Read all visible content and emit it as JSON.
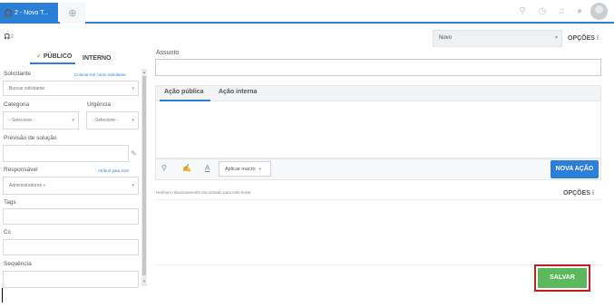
{
  "top_tabs": {
    "active_label": "2 - Novo T...",
    "new_tab_icon": "plus-circle-icon"
  },
  "top_icons": [
    "search-icon",
    "clock-icon",
    "bell-icon",
    "chat-icon"
  ],
  "ticket_number": "2",
  "status": {
    "selected": "Novo"
  },
  "opcoes_top": "OPÇÕES",
  "left_panel": {
    "tab_public": "PÚBLICO",
    "tab_internal": "INTERNO",
    "solicitante_label": "Solicitante",
    "solicitante_link": "Colocar-me como solicitante",
    "solicitante_placeholder": "Buscar solicitante",
    "categoria_label": "Categoria",
    "categoria_value": "- Selecione -",
    "urgencia_label": "Urgência",
    "urgencia_value": "- Selecione -",
    "previsao_label": "Previsão de solução",
    "responsavel_label": "Responsável",
    "responsavel_link": "Atribuir para mim",
    "responsavel_value": "Administradores »",
    "tags_label": "Tags",
    "cc_label": "Cc",
    "sequencia_label": "Sequência"
  },
  "right_panel": {
    "assunto_label": "Assunto",
    "tab_public_action": "Ação pública",
    "tab_internal_action": "Ação interna",
    "macro_label": "Aplicar macro",
    "nova_acao": "NOVA AÇÃO",
    "nenhum_text": "Nenhum relacionamento encontrado para este ticket",
    "opcoes_mid": "OPÇÕES",
    "save": "SALVAR"
  },
  "colors": {
    "accent": "#2b7fd6",
    "save_green": "#5cb85c",
    "highlight_red": "#c21e1e"
  }
}
